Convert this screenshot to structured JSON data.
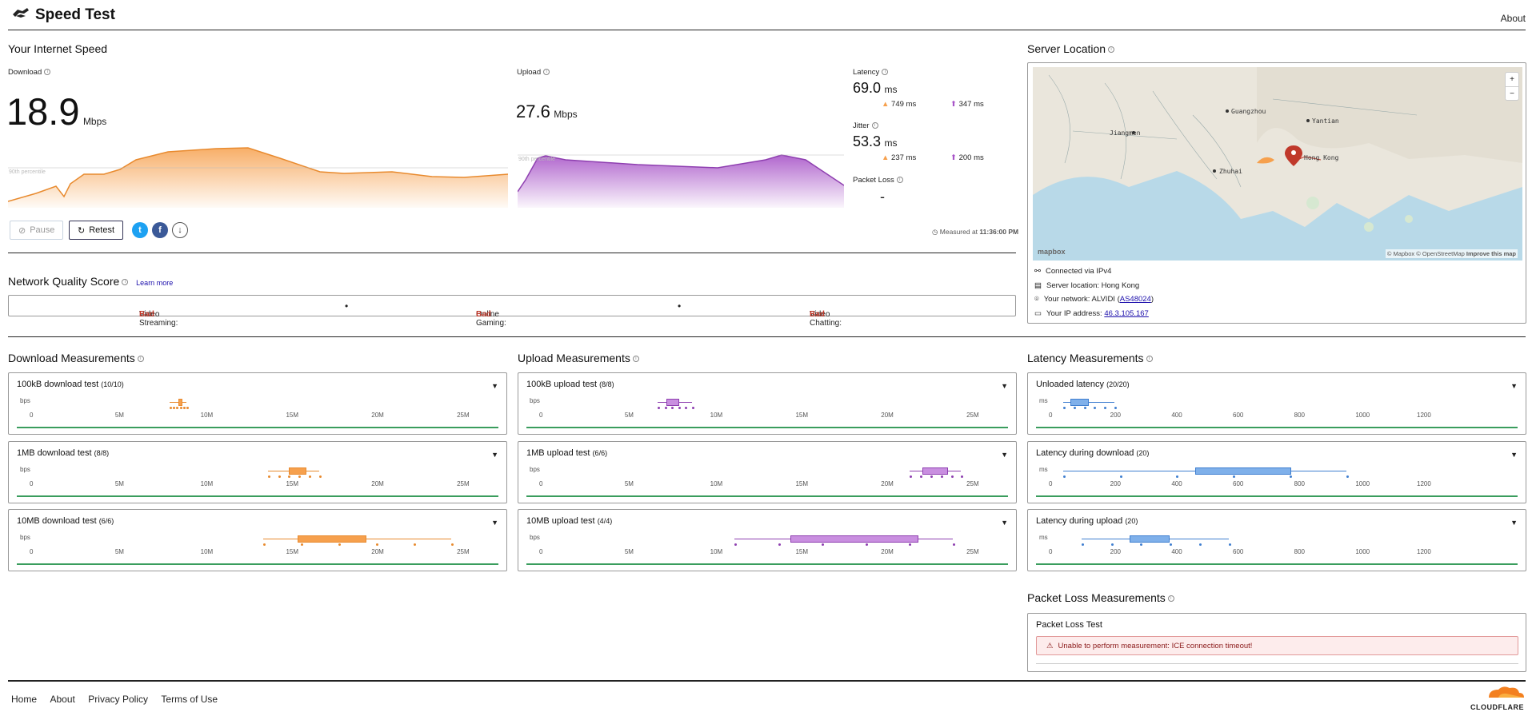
{
  "header": {
    "title": "Speed Test",
    "about": "About"
  },
  "speed": {
    "section_title": "Your Internet Speed",
    "download": {
      "label": "Download",
      "value": "18.9",
      "unit": "Mbps",
      "percentile": "90th percentile"
    },
    "upload": {
      "label": "Upload",
      "value": "27.6",
      "unit": "Mbps",
      "percentile": "90th percentile"
    },
    "latency": {
      "label": "Latency",
      "value": "69.0",
      "unit": "ms",
      "down": "749 ms",
      "up": "347 ms"
    },
    "jitter": {
      "label": "Jitter",
      "value": "53.3",
      "unit": "ms",
      "down": "237 ms",
      "up": "200 ms"
    },
    "packet_loss": {
      "label": "Packet Loss",
      "value": "-"
    },
    "pause_label": "Pause",
    "retest_label": "Retest",
    "measured_prefix": "Measured at",
    "measured_time": "11:36:00 PM"
  },
  "quality": {
    "title": "Network Quality Score",
    "learn_more": "Learn more",
    "items": [
      {
        "label": "Video Streaming:",
        "value": "Bad"
      },
      {
        "label": "Online Gaming:",
        "value": "Bad"
      },
      {
        "label": "Video Chatting:",
        "value": "Bad"
      }
    ]
  },
  "server": {
    "title": "Server Location",
    "map_labels": {
      "guangzhou": "Guangzhou",
      "yantian": "Yantian",
      "jiangmen": "Jiangmen",
      "zhuhai": "Zhuhai",
      "hongkong": "Hong Kong"
    },
    "attribution": "© Mapbox © OpenStreetMap",
    "improve": "Improve this map",
    "mapbox_logo": "mapbox",
    "connected": "Connected via IPv4",
    "location": "Server location: Hong Kong",
    "network_prefix": "Your network: ALVIDI (",
    "network_as": "AS48024",
    "network_suffix": ")",
    "ip_prefix": "Your IP address: ",
    "ip": "46.3.105.167"
  },
  "download_meas": {
    "title": "Download Measurements",
    "unit": "bps",
    "ticks": [
      "0",
      "5M",
      "10M",
      "15M",
      "20M",
      "25M"
    ],
    "tests": [
      {
        "name": "100kB download test",
        "count": "(10/10)"
      },
      {
        "name": "1MB download test",
        "count": "(8/8)"
      },
      {
        "name": "10MB download test",
        "count": "(6/6)"
      }
    ]
  },
  "upload_meas": {
    "title": "Upload Measurements",
    "unit": "bps",
    "ticks": [
      "0",
      "5M",
      "10M",
      "15M",
      "20M",
      "25M"
    ],
    "tests": [
      {
        "name": "100kB upload test",
        "count": "(8/8)"
      },
      {
        "name": "1MB upload test",
        "count": "(6/6)"
      },
      {
        "name": "10MB upload test",
        "count": "(4/4)"
      }
    ]
  },
  "latency_meas": {
    "title": "Latency Measurements",
    "unit": "ms",
    "ticks": [
      "0",
      "200",
      "400",
      "600",
      "800",
      "1000",
      "1200"
    ],
    "tests": [
      {
        "name": "Unloaded latency",
        "count": "(20/20)"
      },
      {
        "name": "Latency during download",
        "count": "(20)"
      },
      {
        "name": "Latency during upload",
        "count": "(20)"
      }
    ]
  },
  "packet_loss_meas": {
    "title": "Packet Loss Measurements",
    "card_title": "Packet Loss Test",
    "error": "Unable to perform measurement: ICE connection timeout!"
  },
  "footer": {
    "links": [
      "Home",
      "About",
      "Privacy Policy",
      "Terms of Use"
    ],
    "brand": "CLOUDFLARE"
  },
  "colors": {
    "download": "#f6a04d",
    "upload": "#a855c8",
    "latency": "#4a90e2",
    "bad": "#c0392b",
    "good_line": "#3a9d5d"
  }
}
